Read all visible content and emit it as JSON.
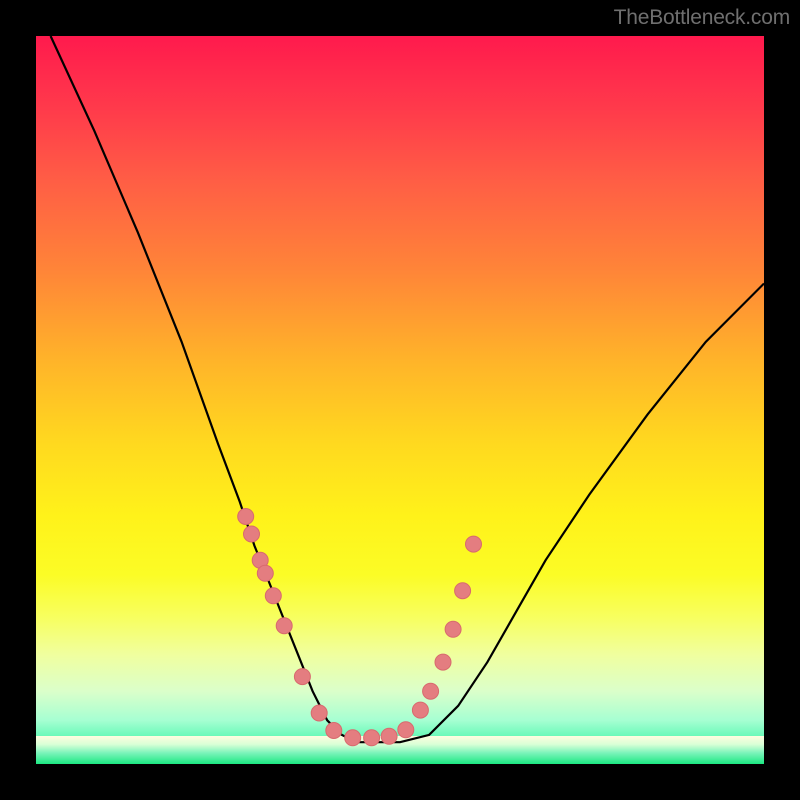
{
  "watermark": "TheBottleneck.com",
  "colors": {
    "frame": "#000000",
    "curve_stroke": "#000000",
    "dot_fill": "#e47d80",
    "dot_stroke": "#d86a6e"
  },
  "chart_data": {
    "type": "line",
    "title": "",
    "xlabel": "",
    "ylabel": "",
    "xlim": [
      0,
      100
    ],
    "ylim": [
      0,
      100
    ],
    "note": "No numeric axes or tick labels are rendered in the image. Values below are normalized 0–100 estimates read from the pixels (x left→right, y bottom→top).",
    "series": [
      {
        "name": "curve",
        "x": [
          2,
          8,
          14,
          20,
          25,
          28,
          30,
          32,
          34,
          36,
          38,
          40,
          42,
          44,
          46,
          50,
          54,
          58,
          62,
          66,
          70,
          76,
          84,
          92,
          100
        ],
        "y": [
          100,
          87,
          73,
          58,
          44,
          36,
          30,
          25,
          20,
          15,
          10,
          6,
          4,
          3,
          3,
          3,
          4,
          8,
          14,
          21,
          28,
          37,
          48,
          58,
          66
        ]
      }
    ],
    "dots": {
      "name": "highlight-points",
      "x": [
        28.8,
        29.6,
        30.8,
        31.5,
        32.6,
        34.1,
        36.6,
        38.9,
        40.9,
        43.5,
        46.1,
        48.5,
        50.8,
        52.8,
        54.2,
        55.9,
        57.3,
        58.6,
        60.1
      ],
      "y": [
        34.0,
        31.6,
        28.0,
        26.2,
        23.1,
        19.0,
        12.0,
        7.0,
        4.6,
        3.6,
        3.6,
        3.8,
        4.7,
        7.4,
        10.0,
        14.0,
        18.5,
        23.8,
        30.2
      ]
    }
  }
}
